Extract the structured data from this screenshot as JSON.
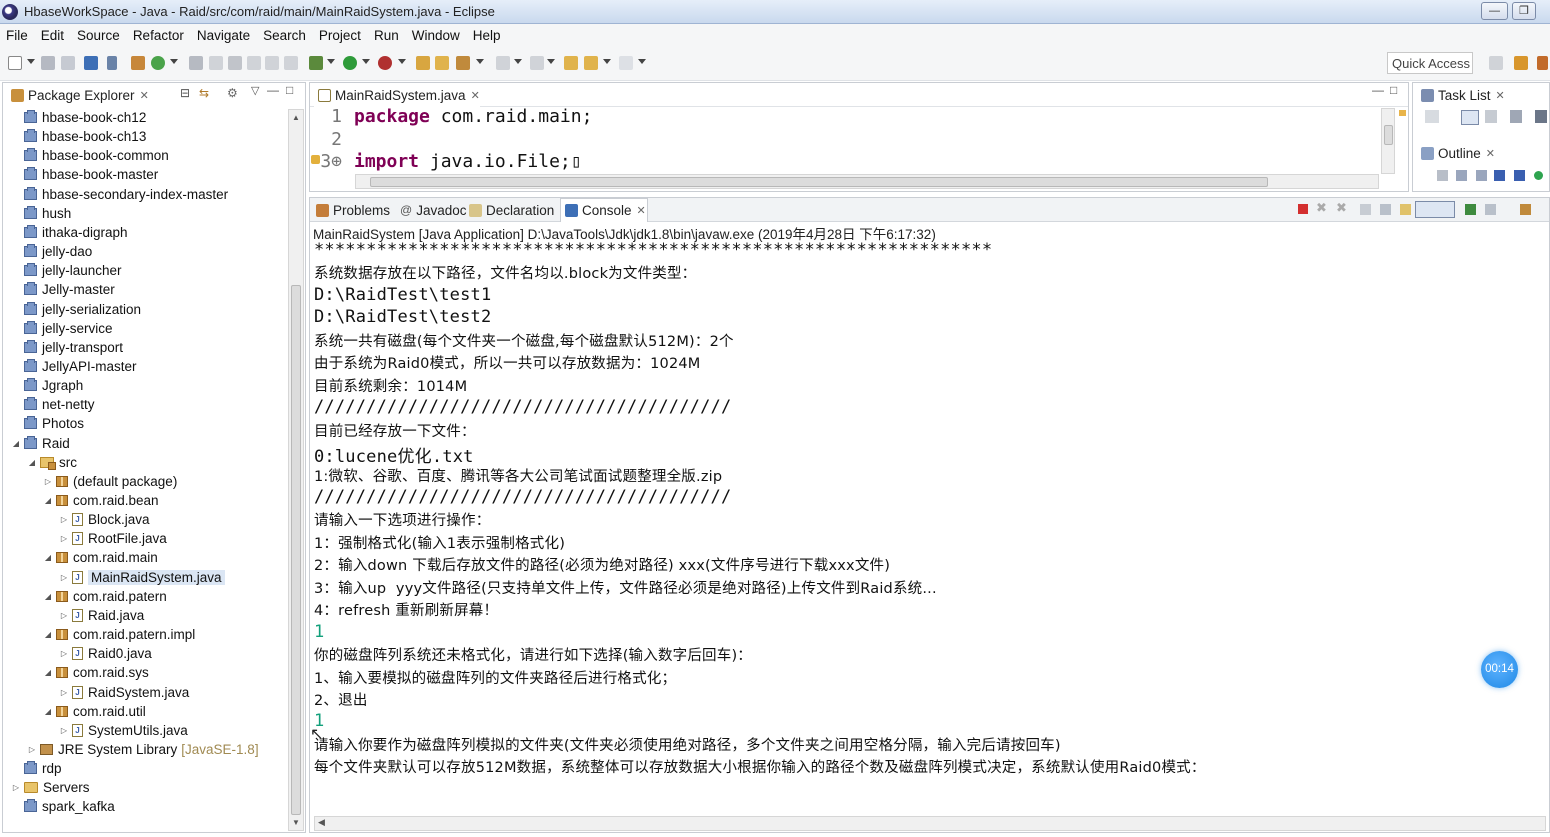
{
  "window": {
    "title": "HbaseWorkSpace - Java - Raid/src/com/raid/main/MainRaidSystem.java - Eclipse",
    "minimize": "—",
    "restore": "❐",
    "close": "✕"
  },
  "menu": [
    "File",
    "Edit",
    "Source",
    "Refactor",
    "Navigate",
    "Search",
    "Project",
    "Run",
    "Window",
    "Help"
  ],
  "toolbar": {
    "quick_access": "Quick Access"
  },
  "package_explorer": {
    "tab_label": "Package Explorer",
    "items": [
      {
        "label": "hbase-book-ch12",
        "depth": 0,
        "kind": "proj",
        "twisty": ""
      },
      {
        "label": "hbase-book-ch13",
        "depth": 0,
        "kind": "proj",
        "twisty": ""
      },
      {
        "label": "hbase-book-common",
        "depth": 0,
        "kind": "proj",
        "twisty": ""
      },
      {
        "label": "hbase-book-master",
        "depth": 0,
        "kind": "proj",
        "twisty": ""
      },
      {
        "label": "hbase-secondary-index-master",
        "depth": 0,
        "kind": "proj",
        "twisty": ""
      },
      {
        "label": "hush",
        "depth": 0,
        "kind": "proj",
        "twisty": ""
      },
      {
        "label": "ithaka-digraph",
        "depth": 0,
        "kind": "proj",
        "twisty": ""
      },
      {
        "label": "jelly-dao",
        "depth": 0,
        "kind": "proj",
        "twisty": ""
      },
      {
        "label": "jelly-launcher",
        "depth": 0,
        "kind": "proj",
        "twisty": ""
      },
      {
        "label": "Jelly-master",
        "depth": 0,
        "kind": "proj",
        "twisty": ""
      },
      {
        "label": "jelly-serialization",
        "depth": 0,
        "kind": "proj",
        "twisty": ""
      },
      {
        "label": "jelly-service",
        "depth": 0,
        "kind": "proj",
        "twisty": ""
      },
      {
        "label": "jelly-transport",
        "depth": 0,
        "kind": "proj",
        "twisty": ""
      },
      {
        "label": "JellyAPI-master",
        "depth": 0,
        "kind": "proj",
        "twisty": ""
      },
      {
        "label": "Jgraph",
        "depth": 0,
        "kind": "proj",
        "twisty": ""
      },
      {
        "label": "net-netty",
        "depth": 0,
        "kind": "proj",
        "twisty": ""
      },
      {
        "label": "Photos",
        "depth": 0,
        "kind": "proj",
        "twisty": ""
      },
      {
        "label": "Raid",
        "depth": 0,
        "kind": "proj",
        "twisty": "◢"
      },
      {
        "label": "src",
        "depth": 1,
        "kind": "src",
        "twisty": "◢"
      },
      {
        "label": "(default package)",
        "depth": 2,
        "kind": "pkg",
        "twisty": "▷"
      },
      {
        "label": "com.raid.bean",
        "depth": 2,
        "kind": "pkg",
        "twisty": "◢"
      },
      {
        "label": "Block.java",
        "depth": 3,
        "kind": "java",
        "twisty": "▷"
      },
      {
        "label": "RootFile.java",
        "depth": 3,
        "kind": "java",
        "twisty": "▷"
      },
      {
        "label": "com.raid.main",
        "depth": 2,
        "kind": "pkg",
        "twisty": "◢"
      },
      {
        "label": "MainRaidSystem.java",
        "depth": 3,
        "kind": "java",
        "twisty": "▷",
        "selected": true
      },
      {
        "label": "com.raid.patern",
        "depth": 2,
        "kind": "pkg",
        "twisty": "◢"
      },
      {
        "label": "Raid.java",
        "depth": 3,
        "kind": "java",
        "twisty": "▷"
      },
      {
        "label": "com.raid.patern.impl",
        "depth": 2,
        "kind": "pkg",
        "twisty": "◢"
      },
      {
        "label": "Raid0.java",
        "depth": 3,
        "kind": "java",
        "twisty": "▷"
      },
      {
        "label": "com.raid.sys",
        "depth": 2,
        "kind": "pkg",
        "twisty": "◢"
      },
      {
        "label": "RaidSystem.java",
        "depth": 3,
        "kind": "java",
        "twisty": "▷"
      },
      {
        "label": "com.raid.util",
        "depth": 2,
        "kind": "pkg",
        "twisty": "◢"
      },
      {
        "label": "SystemUtils.java",
        "depth": 3,
        "kind": "java",
        "twisty": "▷"
      },
      {
        "label": "JRE System Library",
        "suffix": "[JavaSE-1.8]",
        "depth": 1,
        "kind": "lib",
        "twisty": "▷"
      },
      {
        "label": "rdp",
        "depth": 0,
        "kind": "proj",
        "twisty": ""
      },
      {
        "label": "Servers",
        "depth": 0,
        "kind": "fold",
        "twisty": "▷"
      },
      {
        "label": "spark_kafka",
        "depth": 0,
        "kind": "proj",
        "twisty": ""
      }
    ]
  },
  "editor": {
    "tab_label": "MainRaidSystem.java",
    "lines": [
      {
        "num": "1",
        "kw": "package",
        "rest": " com.raid.main;"
      },
      {
        "num": "2",
        "kw": "",
        "rest": ""
      },
      {
        "num": "3⊕",
        "kw": "import",
        "rest": " java.io.File;▯"
      }
    ]
  },
  "right": {
    "task_list": "Task List",
    "outline": "Outline"
  },
  "bottom_tabs": [
    "Problems",
    "Javadoc",
    "Declaration",
    "Console"
  ],
  "console": {
    "header": "MainRaidSystem [Java Application] D:\\JavaTools\\Jdk\\jdk1.8\\bin\\javaw.exe (2019年4月28日 下午6:17:32)",
    "lines": [
      {
        "t": "*****************************************************************",
        "s": ""
      },
      {
        "t": "系统数据存放在以下路径，文件名均以.block为文件类型：",
        "s": "cn"
      },
      {
        "t": "D:\\RaidTest\\test1",
        "s": ""
      },
      {
        "t": "D:\\RaidTest\\test2",
        "s": ""
      },
      {
        "t": "系统一共有磁盘(每个文件夹一个磁盘,每个磁盘默认512M)：2个",
        "s": "cn"
      },
      {
        "t": "由于系统为Raid0模式，所以一共可以存放数据为：1024M",
        "s": "cn"
      },
      {
        "t": "目前系统剩余：1014M",
        "s": "cn"
      },
      {
        "t": "////////////////////////////////////////",
        "s": ""
      },
      {
        "t": "目前已经存放一下文件：",
        "s": "cn"
      },
      {
        "t": "0:lucene优化.txt",
        "s": ""
      },
      {
        "t": "1:微软、谷歌、百度、腾讯等各大公司笔试面试题整理全版.zip",
        "s": "cn"
      },
      {
        "t": "////////////////////////////////////////",
        "s": ""
      },
      {
        "t": "请输入一下选项进行操作：",
        "s": "cn"
      },
      {
        "t": "1：强制格式化(输入1表示强制格式化)",
        "s": "cn"
      },
      {
        "t": "2：输入down 下载后存放文件的路径(必须为绝对路径) xxx(文件序号进行下载xxx文件)",
        "s": "cn"
      },
      {
        "t": "3：输入up  yyy文件路径(只支持单文件上传，文件路径必须是绝对路径)上传文件到Raid系统...",
        "s": "cn"
      },
      {
        "t": "4：refresh 重新刷新屏幕！",
        "s": "cn"
      },
      {
        "t": "1",
        "s": "in"
      },
      {
        "t": "你的磁盘阵列系统还未格式化，请进行如下选择(输入数字后回车)：",
        "s": "cn"
      },
      {
        "t": "1、输入要模拟的磁盘阵列的文件夹路径后进行格式化；",
        "s": "cn"
      },
      {
        "t": "2、退出",
        "s": "cn"
      },
      {
        "t": "1",
        "s": "in"
      },
      {
        "t": "请输入你要作为磁盘阵列模拟的文件夹(文件夹必须使用绝对路径，多个文件夹之间用空格分隔，输入完后请按回车)",
        "s": "cn"
      },
      {
        "t": "每个文件夹默认可以存放512M数据，系统整体可以存放数据大小根据你输入的路径个数及磁盘阵列模式决定，系统默认使用Raid0模式：",
        "s": "cn"
      }
    ]
  },
  "timer": "00:14"
}
